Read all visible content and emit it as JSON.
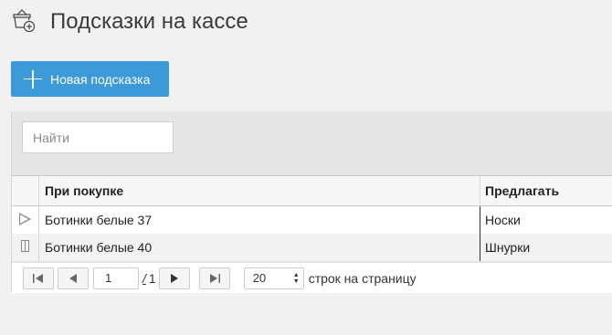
{
  "header": {
    "title": "Подсказки на кассе",
    "icon": "basket-add-icon"
  },
  "toolbar": {
    "new_label": "Новая подсказка",
    "new_icon": "plus-icon"
  },
  "search": {
    "placeholder": "Найти",
    "value": ""
  },
  "table": {
    "columns": [
      "При покупке",
      "Предлагать"
    ],
    "rows": [
      {
        "status_icon": "play-icon",
        "purchase": "Ботинки белые 37",
        "offer": "Носки"
      },
      {
        "status_icon": "pause-icon",
        "purchase": "Ботинки белые 40",
        "offer": "Шнурки"
      }
    ]
  },
  "pager": {
    "current_page": "1",
    "separator": "/",
    "total_pages": "1",
    "rows_per_page": "20",
    "rows_per_page_label": "строк на страницу"
  },
  "colors": {
    "accent": "#3d9ad9",
    "background": "#f1f1f1"
  }
}
